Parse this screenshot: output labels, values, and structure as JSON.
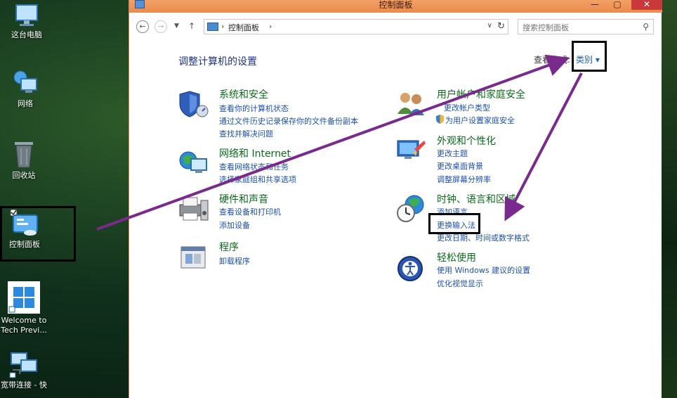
{
  "desktop": {
    "icons": [
      {
        "label": "这台电脑",
        "icon": "computer-icon"
      },
      {
        "label": "网络",
        "icon": "network-icon"
      },
      {
        "label": "回收站",
        "icon": "recycle-bin-icon"
      },
      {
        "label": "控制面板",
        "icon": "control-panel-icon"
      },
      {
        "label": "Welcome to",
        "label2": "Tech Previ...",
        "icon": "windows-logo-icon"
      },
      {
        "label": "宽带连接 - 快",
        "icon": "broadband-connection-icon"
      }
    ]
  },
  "window": {
    "title": "控制面板",
    "address": {
      "crumb": "控制面板"
    },
    "search": {
      "placeholder": "搜索控制面板"
    },
    "page_title": "调整计算机的设置",
    "view_by_label": "查看方式:",
    "view_by_value": "类别 ▾",
    "categories_left": [
      {
        "title": "系统和安全",
        "icon": "shield-icon",
        "links": [
          "查看你的计算机状态",
          "通过文件历史记录保存你的文件备份副本",
          "查找并解决问题"
        ]
      },
      {
        "title": "网络和 Internet",
        "icon": "globe-network-icon",
        "links": [
          "查看网络状态和任务",
          "选择家庭组和共享选项"
        ]
      },
      {
        "title": "硬件和声音",
        "icon": "printer-speaker-icon",
        "links": [
          "查看设备和打印机",
          "添加设备"
        ]
      },
      {
        "title": "程序",
        "icon": "programs-icon",
        "links": [
          "卸载程序"
        ]
      }
    ],
    "categories_right": [
      {
        "title": "用户帐户和家庭安全",
        "icon": "users-icon",
        "links": [
          "更改帐户类型",
          "为用户设置家庭安全"
        ]
      },
      {
        "title": "外观和个性化",
        "icon": "appearance-icon",
        "links": [
          "更改主题",
          "更改桌面背景",
          "调整屏幕分辨率"
        ]
      },
      {
        "title": "时钟、语言和区域",
        "icon": "clock-globe-icon",
        "links": [
          "添加语言",
          "更换输入法",
          "更改日期、时间或数字格式"
        ]
      },
      {
        "title": "轻松使用",
        "icon": "ease-of-access-icon",
        "links": [
          "使用 Windows 建议的设置",
          "优化视觉显示"
        ]
      }
    ]
  },
  "colors": {
    "titlebar": "#ec8a4c",
    "category_title": "#0b6a1a",
    "link": "#1c4fb0",
    "page_title": "#1e3287",
    "annotation_arrow": "#7a2a8c"
  }
}
